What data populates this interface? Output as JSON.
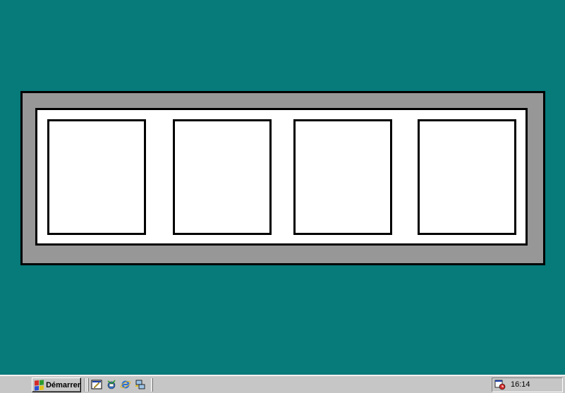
{
  "taskbar": {
    "start_label": "Démarrer",
    "quick_launch": [
      {
        "name": "show-desktop-icon"
      },
      {
        "name": "outlook-express-icon"
      },
      {
        "name": "internet-explorer-icon"
      },
      {
        "name": "network-icon"
      }
    ],
    "tray": {
      "icon": "scheduler-icon",
      "clock": "16:14"
    }
  },
  "colors": {
    "desktop": "#077a7a",
    "frame": "#979797",
    "taskbar": "#c6c6c6"
  }
}
